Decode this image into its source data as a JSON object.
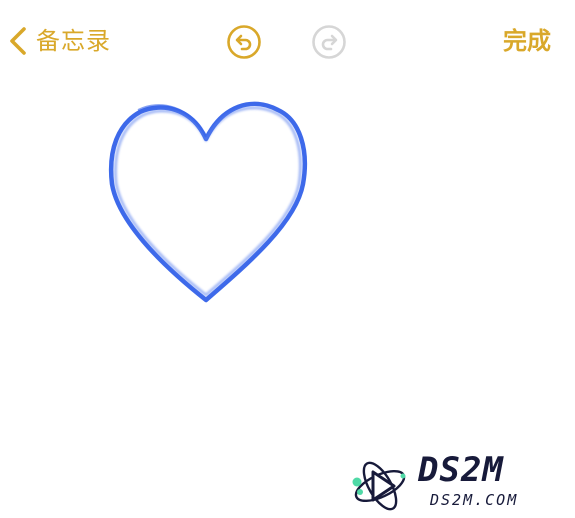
{
  "toolbar": {
    "back_label": "备忘录",
    "done_label": "完成",
    "undo_icon": "undo-icon",
    "redo_icon": "redo-icon",
    "undo_enabled": true,
    "redo_enabled": false
  },
  "colors": {
    "accent": "#d9a82a",
    "disabled": "#d6d6d6",
    "ink": "#3563e9"
  },
  "canvas": {
    "drawing": "heart-sketch"
  },
  "watermark": {
    "title": "DS2M",
    "subtitle": "DS2M.COM"
  }
}
